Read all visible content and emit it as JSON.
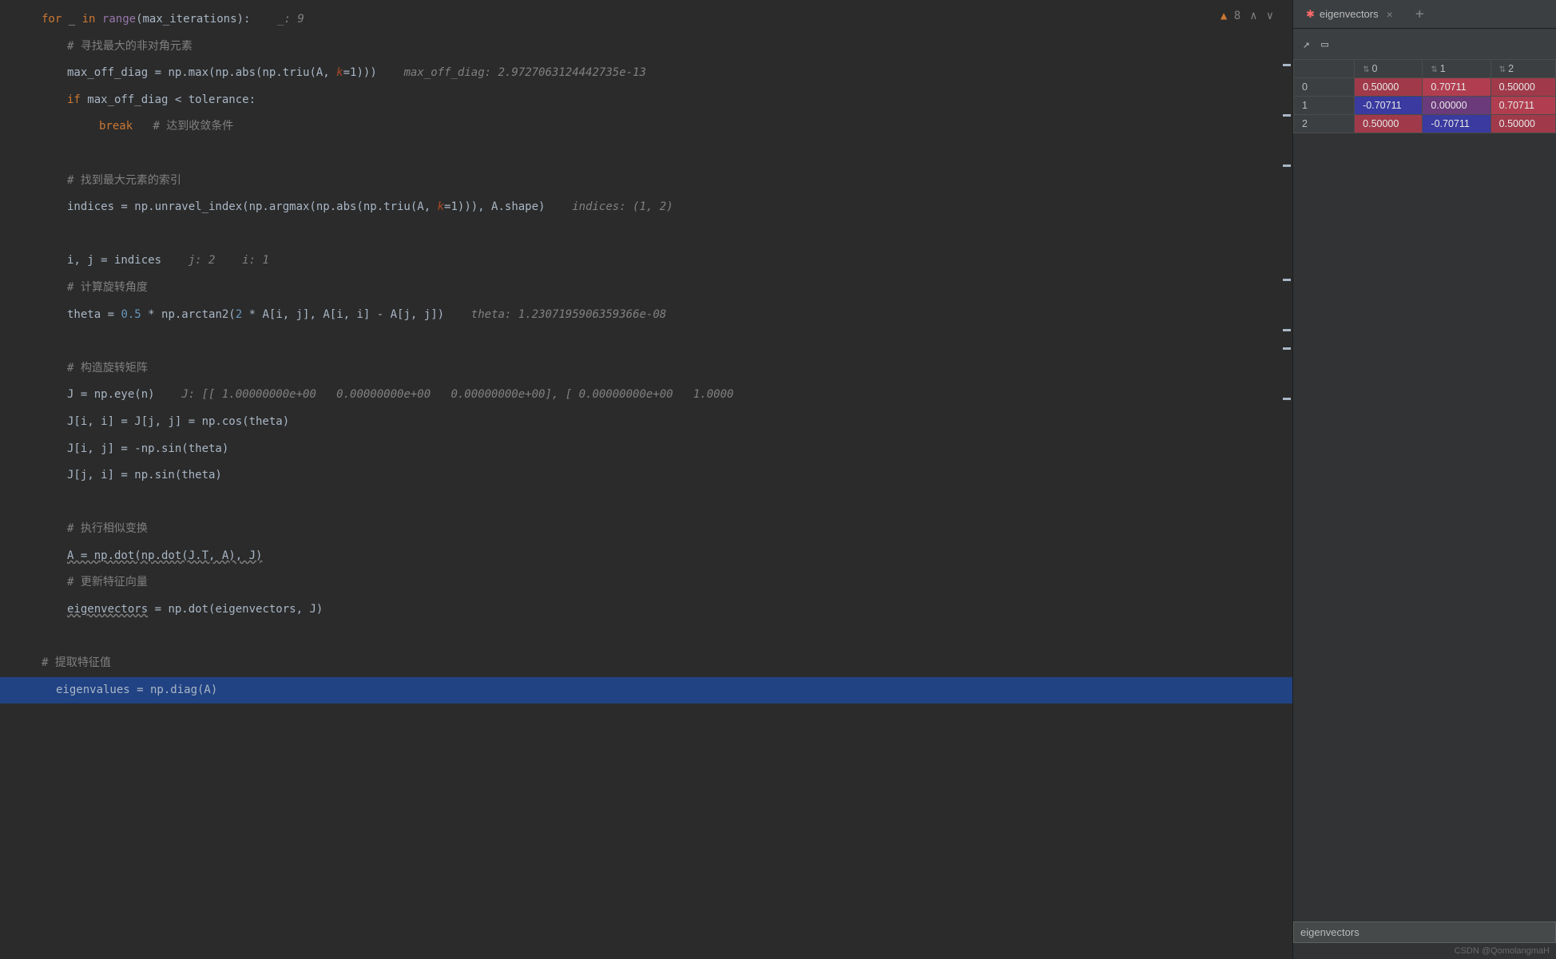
{
  "editor": {
    "inspect": {
      "warn_count": "8"
    },
    "lines": {
      "for_line": {
        "kw_for": "for",
        "var": "_",
        "kw_in": "in",
        "func": "range",
        "arg": "max_iterations",
        "hint": "_: 9"
      },
      "c1": "# 寻找最大的非对角元素",
      "l_maxoff": {
        "lhs": "max_off_diag",
        "eq": " = np.max(np.abs(np.triu(A, ",
        "pk": "k",
        "pv": "=1",
        "tail": ")))",
        "hint": "max_off_diag: 2.9727063124442735e-13"
      },
      "l_if": {
        "kw": "if",
        "cond": " max_off_diag < tolerance:"
      },
      "l_break": {
        "kw": "break",
        "cmt": "   # 达到收敛条件"
      },
      "c2": "# 找到最大元素的索引",
      "l_indices": {
        "lhs": "indices = np.unravel_index(np.argmax(np.abs(np.triu(A, ",
        "pk": "k",
        "pv": "=1",
        "tail": "))), A.shape)",
        "hint": "indices: (1, 2)"
      },
      "l_ij": {
        "code": "i, j = indices",
        "hint1": "j: 2",
        "hint2": "i: 1"
      },
      "c3": "# 计算旋转角度",
      "l_theta": {
        "pre": "theta = ",
        "num": "0.5",
        "mid": " * np.arctan2(",
        "n2": "2",
        "post": " * A[i, j], A[i, i] - A[j, j])",
        "hint": "theta: 1.2307195906359366e-08"
      },
      "c4": "# 构造旋转矩阵",
      "l_J": {
        "code": "J = np.eye(n)",
        "hint": "J: [[ 1.00000000e+00   0.00000000e+00   0.00000000e+00], [ 0.00000000e+00   1.0000"
      },
      "l_Jii": "J[i, i] = J[j, j] = np.cos(theta)",
      "l_Jij": "J[i, j] = -np.sin(theta)",
      "l_Jji": "J[j, i] = np.sin(theta)",
      "c5": "# 执行相似变换",
      "l_A": "A = np.dot(np.dot(J.T, A), J)",
      "c6": "# 更新特征向量",
      "l_eigv": {
        "lhs": "eigenvectors",
        "rest": " = np.dot(eigenvectors, J)"
      },
      "c7": "# 提取特征值",
      "l_eigval": "eigenvalues = np.diag(A)"
    }
  },
  "panel": {
    "tab_title": "eigenvectors",
    "footer_input": "eigenvectors",
    "watermark": "CSDN @QomolangmaH",
    "chart_data": {
      "type": "table",
      "columns": [
        "0",
        "1",
        "2"
      ],
      "rows": [
        {
          "idx": "0",
          "vals": [
            "0.50000",
            "0.70711",
            "0.50000"
          ]
        },
        {
          "idx": "1",
          "vals": [
            "-0.70711",
            "0.00000",
            "0.70711"
          ]
        },
        {
          "idx": "2",
          "vals": [
            "0.50000",
            "-0.70711",
            "0.50000"
          ]
        }
      ]
    }
  }
}
